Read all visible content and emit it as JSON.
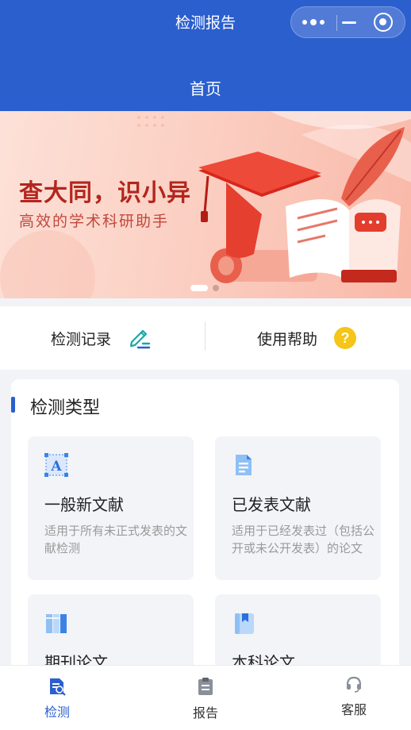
{
  "navbar": {
    "title": "检测报告"
  },
  "header": {
    "page_title": "首页"
  },
  "banner": {
    "headline": "查大同，识小异",
    "subtitle": "高效的学术科研助手",
    "active_slide": 1,
    "slide_count": 2
  },
  "quick_actions": [
    {
      "label": "检测记录",
      "icon": "edit-pen-icon"
    },
    {
      "label": "使用帮助",
      "icon": "help-icon"
    }
  ],
  "section": {
    "title": "检测类型",
    "tiles": [
      {
        "name": "一般新文献",
        "desc": "适用于所有未正式发表的文献检测",
        "icon": "letter-a-icon"
      },
      {
        "name": "已发表文献",
        "desc": "适用于已经发表过（包括公开或未公开发表）的论文",
        "icon": "document-icon"
      },
      {
        "name": "期刊论文",
        "desc": "",
        "icon": "book-columns-icon"
      },
      {
        "name": "本科论文",
        "desc": "",
        "icon": "bookmark-book-icon"
      }
    ]
  },
  "tabbar": [
    {
      "label": "检测",
      "icon": "detect-doc-icon",
      "active": true
    },
    {
      "label": "报告",
      "icon": "clipboard-icon",
      "active": false
    },
    {
      "label": "客服",
      "icon": "headset-icon",
      "active": false
    }
  ],
  "colors": {
    "primary": "#2b5fce",
    "banner_text": "#b3261e",
    "help_yellow": "#f5c518"
  }
}
